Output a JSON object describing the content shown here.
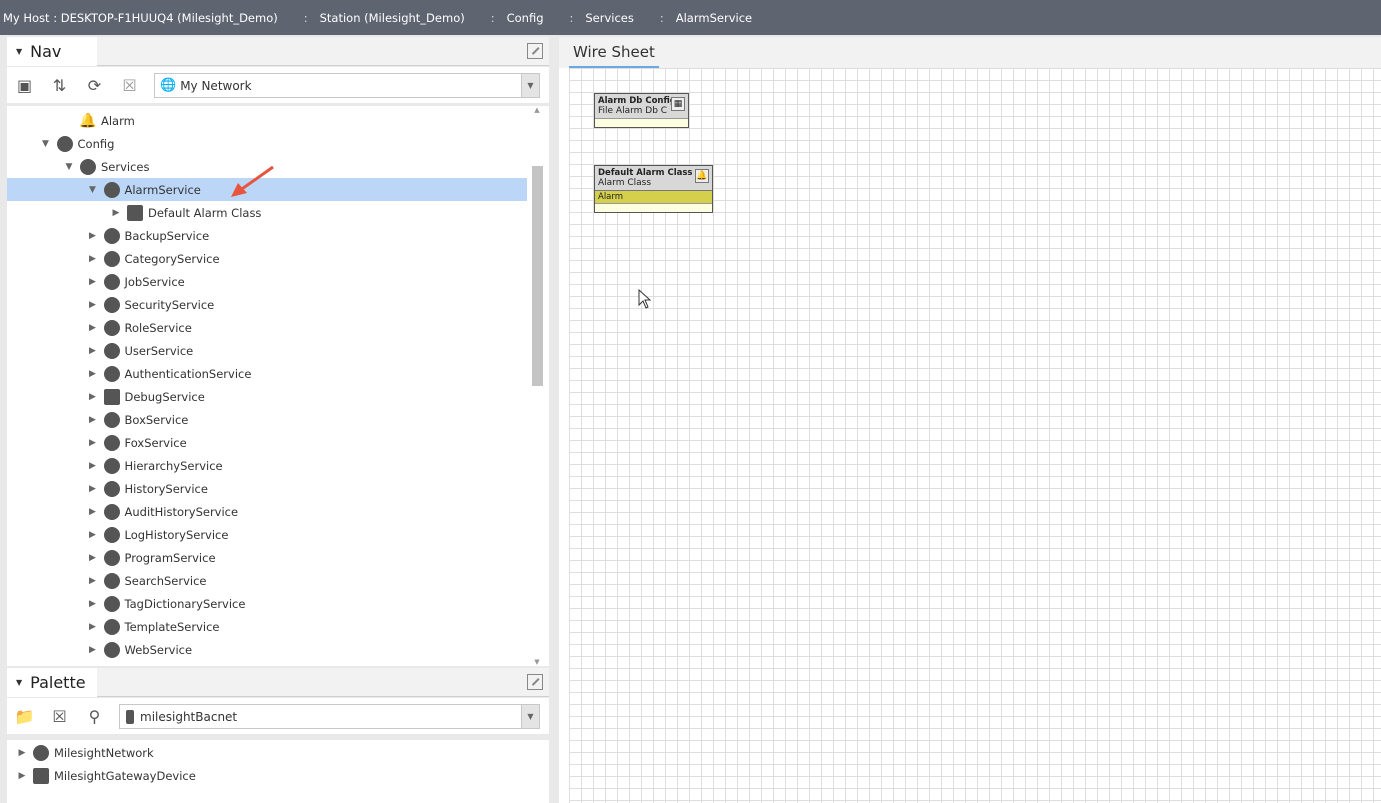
{
  "breadcrumb": [
    {
      "label": "My Host : DESKTOP-F1HUUQ4 (Milesight_Demo)"
    },
    {
      "label": "Station (Milesight_Demo)"
    },
    {
      "label": "Config"
    },
    {
      "label": "Services"
    },
    {
      "label": "AlarmService"
    }
  ],
  "nav": {
    "title": "Nav",
    "network_select": "My Network",
    "tree": [
      {
        "label": "Alarm",
        "icon": "bell-icon",
        "level": 3,
        "expand": ""
      },
      {
        "label": "Config",
        "icon": "config-icon",
        "level": 2,
        "expand": "open"
      },
      {
        "label": "Services",
        "icon": "services-icon",
        "level": 3,
        "expand": "open"
      },
      {
        "label": "AlarmService",
        "icon": "alarm-service-icon",
        "level": 4,
        "expand": "open",
        "selected": true
      },
      {
        "label": "Default Alarm Class",
        "icon": "alarm-class-icon",
        "level": 5,
        "expand": "closed"
      },
      {
        "label": "BackupService",
        "icon": "backup-icon",
        "level": 4,
        "expand": "closed"
      },
      {
        "label": "CategoryService",
        "icon": "category-icon",
        "level": 4,
        "expand": "closed"
      },
      {
        "label": "JobService",
        "icon": "job-icon",
        "level": 4,
        "expand": "closed"
      },
      {
        "label": "SecurityService",
        "icon": "shield-icon",
        "level": 4,
        "expand": "closed"
      },
      {
        "label": "RoleService",
        "icon": "role-icon",
        "level": 4,
        "expand": "closed"
      },
      {
        "label": "UserService",
        "icon": "user-icon",
        "level": 4,
        "expand": "closed"
      },
      {
        "label": "AuthenticationService",
        "icon": "lock-icon",
        "level": 4,
        "expand": "closed"
      },
      {
        "label": "DebugService",
        "icon": "debug-icon",
        "level": 4,
        "expand": "closed"
      },
      {
        "label": "BoxService",
        "icon": "box-icon",
        "level": 4,
        "expand": "closed"
      },
      {
        "label": "FoxService",
        "icon": "fox-icon",
        "level": 4,
        "expand": "closed"
      },
      {
        "label": "HierarchyService",
        "icon": "hierarchy-icon",
        "level": 4,
        "expand": "closed"
      },
      {
        "label": "HistoryService",
        "icon": "history-icon",
        "level": 4,
        "expand": "closed"
      },
      {
        "label": "AuditHistoryService",
        "icon": "audit-icon",
        "level": 4,
        "expand": "closed"
      },
      {
        "label": "LogHistoryService",
        "icon": "log-icon",
        "level": 4,
        "expand": "closed"
      },
      {
        "label": "ProgramService",
        "icon": "program-icon",
        "level": 4,
        "expand": "closed"
      },
      {
        "label": "SearchService",
        "icon": "search-icon",
        "level": 4,
        "expand": "closed"
      },
      {
        "label": "TagDictionaryService",
        "icon": "tag-icon",
        "level": 4,
        "expand": "closed"
      },
      {
        "label": "TemplateService",
        "icon": "template-icon",
        "level": 4,
        "expand": "closed"
      },
      {
        "label": "WebService",
        "icon": "globe-icon",
        "level": 4,
        "expand": "closed"
      }
    ]
  },
  "palette": {
    "title": "Palette",
    "module_select": "milesightBacnet",
    "items": [
      {
        "label": "MilesightNetwork",
        "icon": "network-icon"
      },
      {
        "label": "MilesightGatewayDevice",
        "icon": "gateway-icon"
      }
    ]
  },
  "wiresheet": {
    "tab": "Wire Sheet",
    "nodes": [
      {
        "title": "Alarm Db Config",
        "subtitle": "File Alarm Db C",
        "icon": "file-icon"
      },
      {
        "title": "Default Alarm Class",
        "subtitle": "Alarm Class",
        "slot": "Alarm",
        "icon": "bell-icon"
      }
    ]
  }
}
